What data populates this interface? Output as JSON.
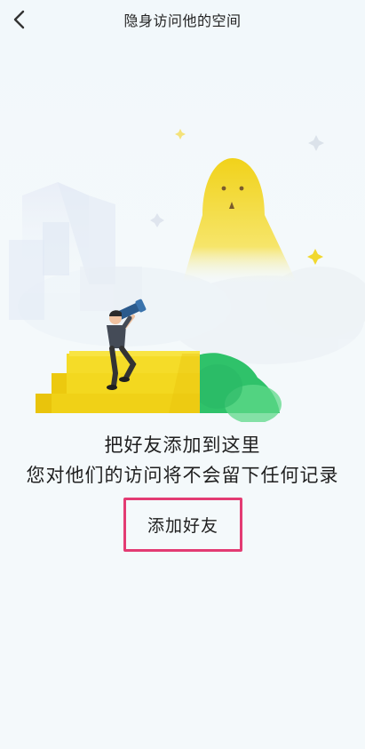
{
  "header": {
    "title": "隐身访问他的空间",
    "back_icon": "chevron-left-icon"
  },
  "empty_state": {
    "line1": "把好友添加到这里",
    "line2": "您对他们的访问将不会留下任何记录"
  },
  "actions": {
    "add_friend_label": "添加好友",
    "highlight_color": "#e33b73"
  },
  "colors": {
    "background": "#f4f9fb",
    "ghost_yellow": "#f3dd2a",
    "stairs_yellow": "#f1d319",
    "hill_green": "#34c56c"
  }
}
